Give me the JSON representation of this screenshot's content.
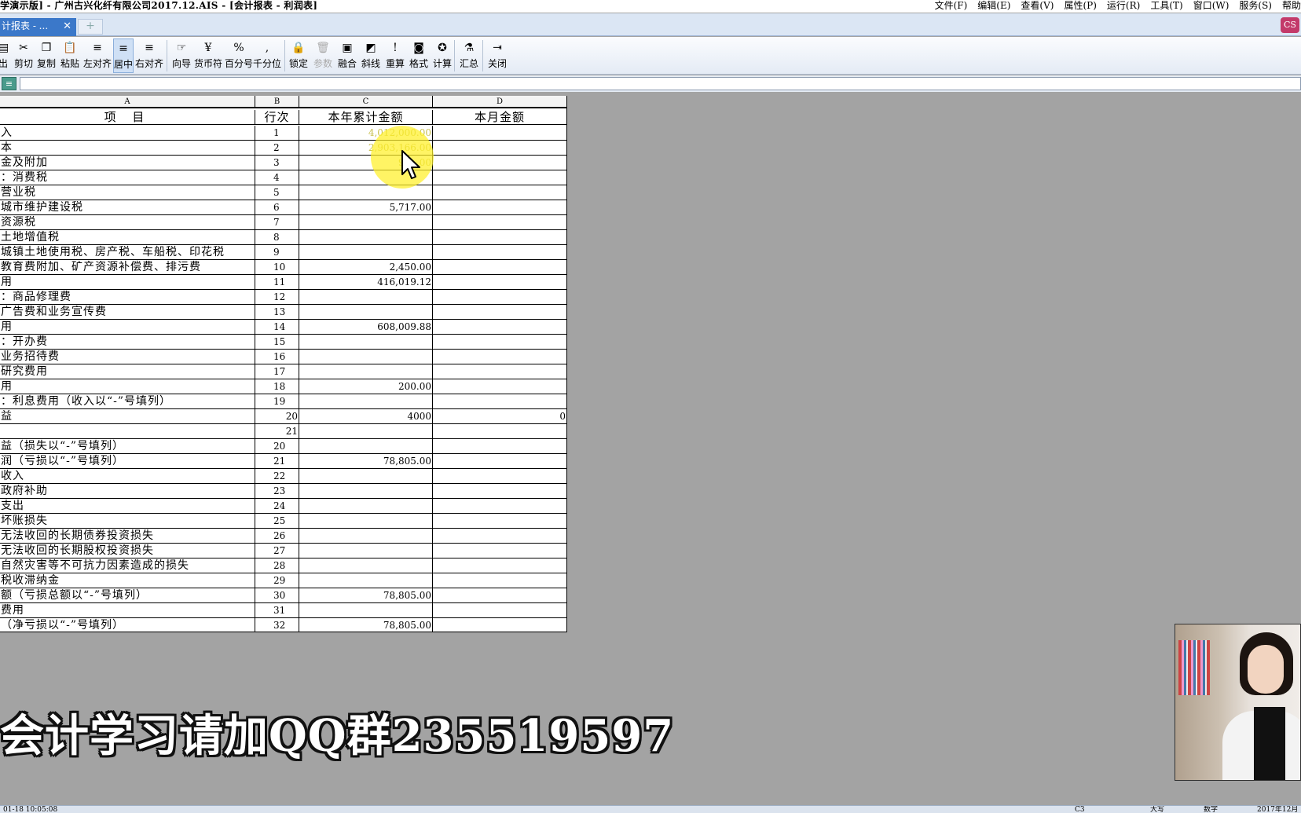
{
  "window": {
    "title": "学演示版] - 广州古兴化纤有限公司2017.12.AIS - [会计报表 - 利润表]",
    "menus": [
      "文件(F)",
      "编辑(E)",
      "查看(V)",
      "属性(P)",
      "运行(R)",
      "工具(T)",
      "窗口(W)",
      "服务(S)",
      "帮助"
    ]
  },
  "tabs": {
    "active_label": "计报表 - ...",
    "close_glyph": "✕",
    "new_glyph": "+",
    "app_icon_glyph": "CS"
  },
  "toolbar": {
    "items": [
      {
        "label": "出",
        "icon": "print-icon",
        "glyph": "▤"
      },
      {
        "label": "剪切",
        "icon": "scissors-icon",
        "glyph": "✂"
      },
      {
        "label": "复制",
        "icon": "copy-icon",
        "glyph": "❐"
      },
      {
        "label": "粘贴",
        "icon": "paste-icon",
        "glyph": "📋"
      },
      {
        "label": "左对齐",
        "icon": "align-left-icon",
        "glyph": "≡"
      },
      {
        "label": "居中",
        "icon": "align-center-icon",
        "glyph": "≡"
      },
      {
        "label": "右对齐",
        "icon": "align-right-icon",
        "glyph": "≡"
      },
      {
        "label": "向导",
        "icon": "wizard-icon",
        "glyph": "☞"
      },
      {
        "label": "货币符",
        "icon": "currency-icon",
        "glyph": "¥"
      },
      {
        "label": "百分号",
        "icon": "percent-icon",
        "glyph": "%"
      },
      {
        "label": "千分位",
        "icon": "comma-icon",
        "glyph": ","
      },
      {
        "label": "锁定",
        "icon": "lock-icon",
        "glyph": "🔒"
      },
      {
        "label": "参数",
        "icon": "trash-icon",
        "glyph": "🗑"
      },
      {
        "label": "融合",
        "icon": "merge-icon",
        "glyph": "▣"
      },
      {
        "label": "斜线",
        "icon": "diagonal-icon",
        "glyph": "◩"
      },
      {
        "label": "重算",
        "icon": "exclamation-icon",
        "glyph": "!"
      },
      {
        "label": "格式",
        "icon": "camera-icon",
        "glyph": "◙"
      },
      {
        "label": "计算",
        "icon": "calc-icon",
        "glyph": "✪"
      },
      {
        "label": "汇总",
        "icon": "summary-icon",
        "glyph": "⚗"
      },
      {
        "label": "关闭",
        "icon": "exit-icon",
        "glyph": "⇥"
      }
    ]
  },
  "formula_bar": {
    "icon": "formula-icon",
    "value": ""
  },
  "sheet": {
    "columns": [
      "A",
      "B",
      "C",
      "D"
    ],
    "header_row": [
      "项 目",
      "行次",
      "本年累计金额",
      "本月金额"
    ],
    "rows": [
      {
        "a": "入",
        "b": "1",
        "c": "4,012,000.00",
        "d": ""
      },
      {
        "a": "本",
        "b": "2",
        "c": "2,903,166.00",
        "d": ""
      },
      {
        "a": "金及附加",
        "b": "3",
        "c": "9,1 .00",
        "d": ""
      },
      {
        "a": "：消费税",
        "b": "4",
        "c": "",
        "d": ""
      },
      {
        "a": "  营业税",
        "b": "5",
        "c": "",
        "d": ""
      },
      {
        "a": "  城市维护建设税",
        "b": "6",
        "c": "5,717.00",
        "d": ""
      },
      {
        "a": "  资源税",
        "b": "7",
        "c": "",
        "d": ""
      },
      {
        "a": "  土地增值税",
        "b": "8",
        "c": "",
        "d": ""
      },
      {
        "a": "  城镇土地使用税、房产税、车船税、印花税",
        "b": "9",
        "c": "",
        "d": ""
      },
      {
        "a": "  教育费附加、矿产资源补偿费、排污费",
        "b": "10",
        "c": "2,450.00",
        "d": ""
      },
      {
        "a": "用",
        "b": "11",
        "c": "416,019.12",
        "d": ""
      },
      {
        "a": "：商品修理费",
        "b": "12",
        "c": "",
        "d": ""
      },
      {
        "a": "  广告费和业务宣传费",
        "b": "13",
        "c": "",
        "d": ""
      },
      {
        "a": "用",
        "b": "14",
        "c": "608,009.88",
        "d": ""
      },
      {
        "a": "：开办费",
        "b": "15",
        "c": "",
        "d": ""
      },
      {
        "a": "  业务招待费",
        "b": "16",
        "c": "",
        "d": ""
      },
      {
        "a": "  研究费用",
        "b": "17",
        "c": "",
        "d": ""
      },
      {
        "a": "用",
        "b": "18",
        "c": "200.00",
        "d": ""
      },
      {
        "a": "：利息费用（收入以“-”号填列）",
        "b": "19",
        "c": "",
        "d": ""
      },
      {
        "a": "益",
        "b": "20",
        "c": "4000",
        "d": "0",
        "b_right": true
      },
      {
        "a": "",
        "b": "21",
        "c": "",
        "d": "",
        "b_right": true
      },
      {
        "a": "益（损失以“-”号填列）",
        "b": "20",
        "c": "",
        "d": ""
      },
      {
        "a": "润（亏损以“-”号填列）",
        "b": "21",
        "c": "78,805.00",
        "d": ""
      },
      {
        "a": "收入",
        "b": "22",
        "c": "",
        "d": ""
      },
      {
        "a": "政府补助",
        "b": "23",
        "c": "",
        "d": ""
      },
      {
        "a": "支出",
        "b": "24",
        "c": "",
        "d": ""
      },
      {
        "a": "坏账损失",
        "b": "25",
        "c": "",
        "d": ""
      },
      {
        "a": "无法收回的长期债券投资损失",
        "b": "26",
        "c": "",
        "d": ""
      },
      {
        "a": "无法收回的长期股权投资损失",
        "b": "27",
        "c": "",
        "d": ""
      },
      {
        "a": "自然灾害等不可抗力因素造成的损失",
        "b": "28",
        "c": "",
        "d": ""
      },
      {
        "a": "税收滞纳金",
        "b": "29",
        "c": "",
        "d": ""
      },
      {
        "a": "额（亏损总额以“-”号填列）",
        "b": "30",
        "c": "78,805.00",
        "d": ""
      },
      {
        "a": "费用",
        "b": "31",
        "c": "",
        "d": ""
      },
      {
        "a": "（净亏损以“-”号填列）",
        "b": "32",
        "c": "78,805.00",
        "d": ""
      }
    ]
  },
  "banner": {
    "text": "会计学习请加QQ群235519597"
  },
  "statusbar": {
    "left": "01-18 10:05:08",
    "cell_ref": "C3",
    "caps": "大写",
    "num": "数字",
    "date": "2017年12月"
  },
  "colors": {
    "highlight": "#fff028",
    "tab_active": "#3b78c9",
    "background": "#a3a3a3"
  }
}
